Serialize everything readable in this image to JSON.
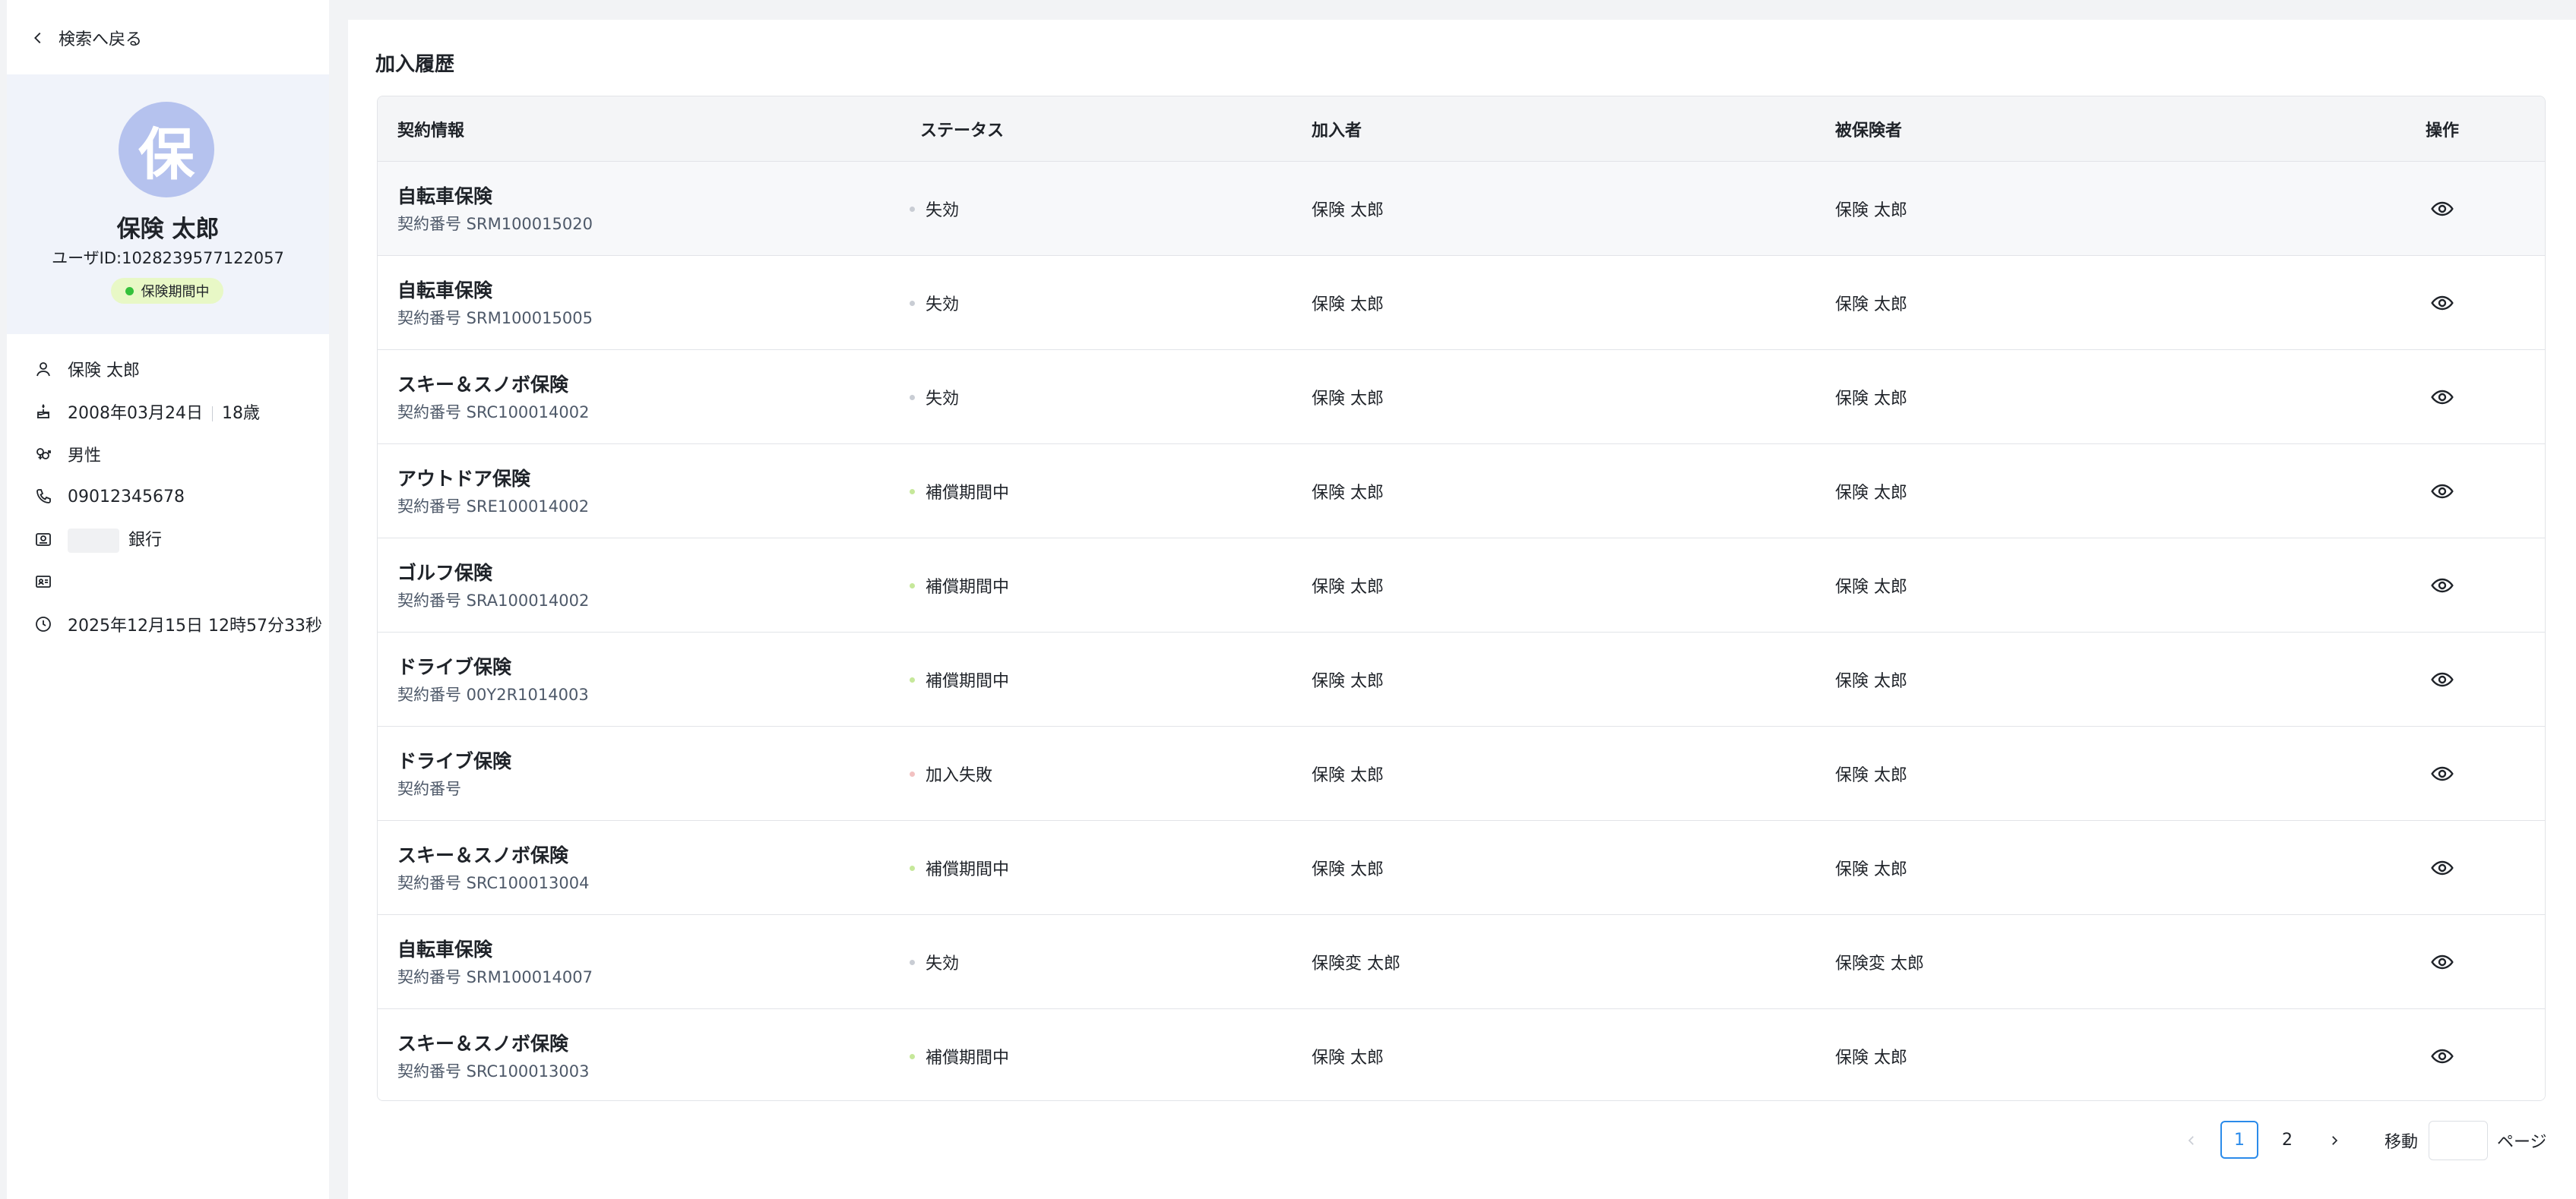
{
  "sidebar": {
    "back_label": "検索へ戻る",
    "profile": {
      "avatar_char": "保",
      "name": "保険 太郎",
      "user_id": "ユーザID:1028239577122057",
      "status": "保険期間中"
    },
    "info": {
      "name": "保険 太郎",
      "birthday": "2008年03月24日",
      "age": "18歳",
      "gender": "男性",
      "phone": "09012345678",
      "bank": "銀行",
      "id_card": "",
      "updated_at": "2025年12月15日 12時57分33秒"
    }
  },
  "main": {
    "section_title": "加入履歴",
    "columns": {
      "contract": "契約情報",
      "status": "ステータス",
      "subscriber": "加入者",
      "insured": "被保険者",
      "action": "操作"
    },
    "rows": [
      {
        "name": "自転車保険",
        "number": "契約番号 SRM100015020",
        "status": "失効",
        "status_color": "#c9cdd4",
        "subscriber": "保険 太郎",
        "insured": "保険 太郎"
      },
      {
        "name": "自転車保険",
        "number": "契約番号 SRM100015005",
        "status": "失効",
        "status_color": "#c9cdd4",
        "subscriber": "保険 太郎",
        "insured": "保険 太郎"
      },
      {
        "name": "スキー＆スノボ保険",
        "number": "契約番号 SRC100014002",
        "status": "失効",
        "status_color": "#c9cdd4",
        "subscriber": "保険 太郎",
        "insured": "保険 太郎"
      },
      {
        "name": "アウトドア保険",
        "number": "契約番号 SRE100014002",
        "status": "補償期間中",
        "status_color": "#c6e89a",
        "subscriber": "保険 太郎",
        "insured": "保険 太郎"
      },
      {
        "name": "ゴルフ保険",
        "number": "契約番号 SRA100014002",
        "status": "補償期間中",
        "status_color": "#c6e89a",
        "subscriber": "保険 太郎",
        "insured": "保険 太郎"
      },
      {
        "name": "ドライブ保険",
        "number": "契約番号 00Y2R1014003",
        "status": "補償期間中",
        "status_color": "#c6e89a",
        "subscriber": "保険 太郎",
        "insured": "保険 太郎"
      },
      {
        "name": "ドライブ保険",
        "number": "契約番号",
        "status": "加入失敗",
        "status_color": "#f2c1c1",
        "subscriber": "保険 太郎",
        "insured": "保険 太郎"
      },
      {
        "name": "スキー＆スノボ保険",
        "number": "契約番号 SRC100013004",
        "status": "補償期間中",
        "status_color": "#c6e89a",
        "subscriber": "保険 太郎",
        "insured": "保険 太郎"
      },
      {
        "name": "自転車保険",
        "number": "契約番号 SRM100014007",
        "status": "失効",
        "status_color": "#c9cdd4",
        "subscriber": "保険変 太郎",
        "insured": "保険変 太郎"
      },
      {
        "name": "スキー＆スノボ保険",
        "number": "契約番号 SRC100013003",
        "status": "補償期間中",
        "status_color": "#c6e89a",
        "subscriber": "保険 太郎",
        "insured": "保険 太郎"
      }
    ],
    "pagination": {
      "pages": [
        "1",
        "2"
      ],
      "current": "1",
      "jump_label": "移動",
      "page_suffix": "ページ",
      "jump_value": ""
    }
  },
  "colors": {
    "accent": "#2b8bea",
    "avatar_bg": "#b5c2ee",
    "status_pill_bg": "#e8f8c6",
    "status_pill_dot": "#34c13b"
  }
}
